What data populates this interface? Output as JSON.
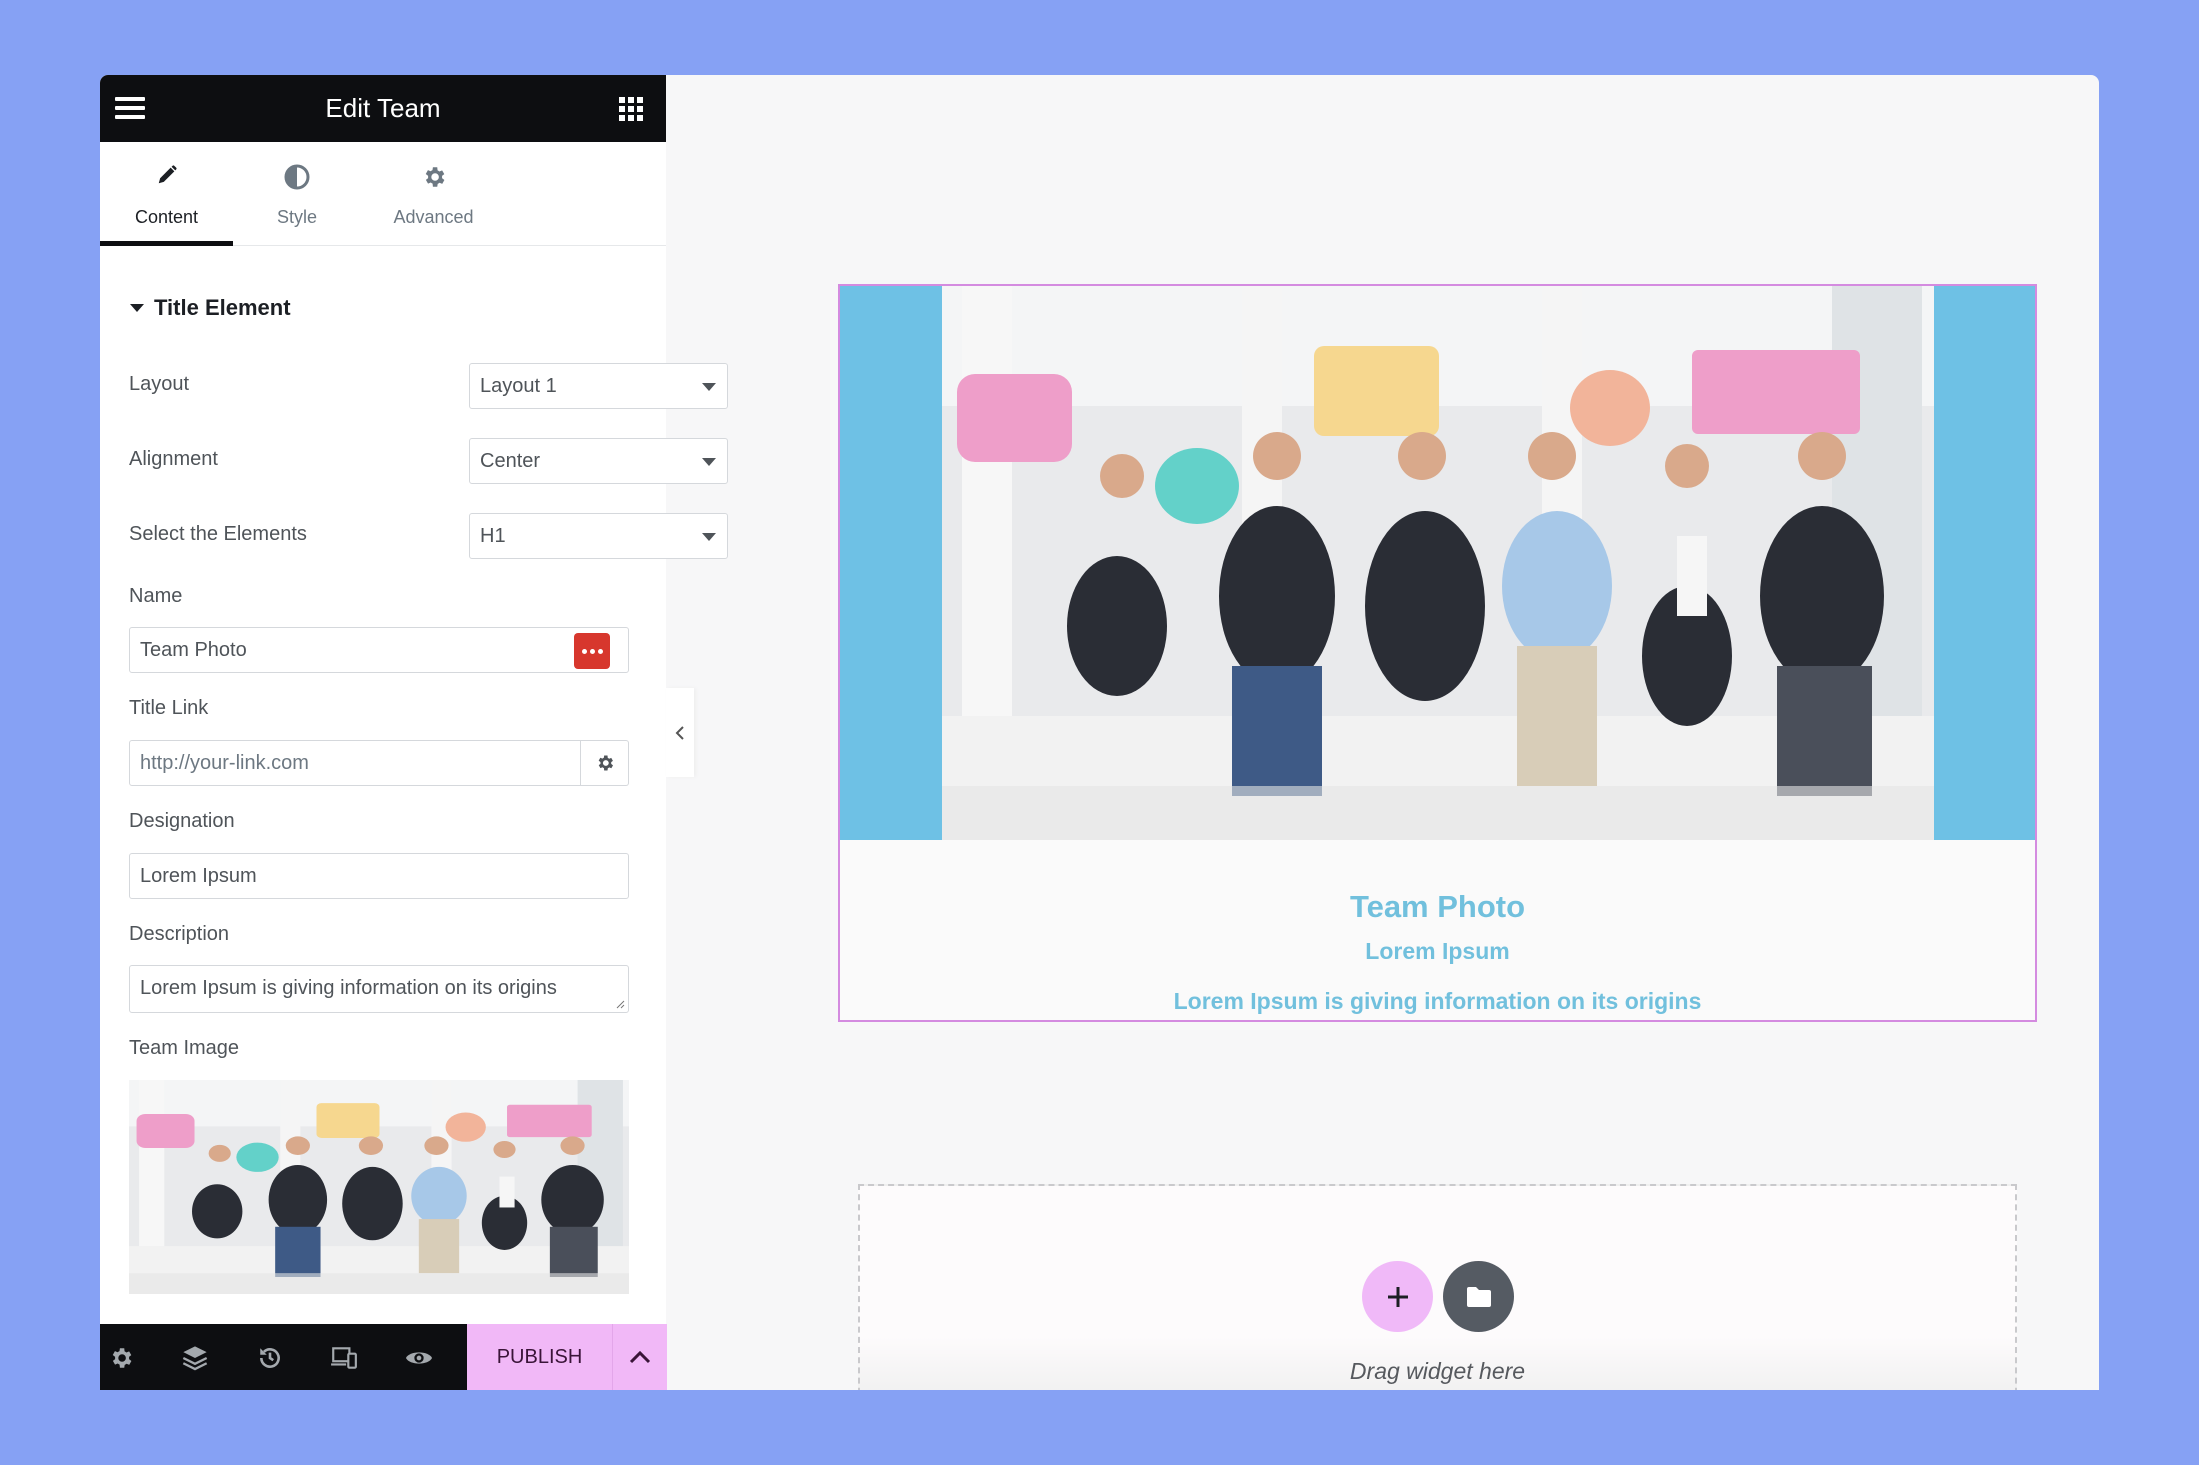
{
  "panel": {
    "title": "Edit Team",
    "tabs": [
      {
        "label": "Content",
        "icon": "pencil-icon",
        "active": true
      },
      {
        "label": "Style",
        "icon": "half-circle-icon",
        "active": false
      },
      {
        "label": "Advanced",
        "icon": "gear-icon",
        "active": false
      }
    ],
    "section_title": "Title Element",
    "fields": {
      "layout": {
        "label": "Layout",
        "value": "Layout 1"
      },
      "alignment": {
        "label": "Alignment",
        "value": "Center"
      },
      "elements": {
        "label": "Select the Elements",
        "value": "H1"
      },
      "name": {
        "label": "Name",
        "value": "Team Photo"
      },
      "title_link": {
        "label": "Title Link",
        "placeholder": "http://your-link.com"
      },
      "designation": {
        "label": "Designation",
        "value": "Lorem Ipsum"
      },
      "description": {
        "label": "Description",
        "value": "Lorem Ipsum is giving information on its origins"
      },
      "team_image": {
        "label": "Team Image"
      }
    },
    "bottom_bar": {
      "icons": [
        "gear-icon",
        "layers-icon",
        "history-icon",
        "responsive-icon",
        "eye-icon"
      ],
      "publish_label": "PUBLISH"
    }
  },
  "canvas": {
    "card": {
      "title": "Team Photo",
      "designation": "Lorem Ipsum",
      "description": "Lorem Ipsum is giving information on its origins"
    },
    "dropzone": {
      "text": "Drag widget here"
    }
  },
  "colors": {
    "background": "#86a1f4",
    "accent_pink": "#f1b8f7",
    "card_text": "#71c0dd",
    "image_bg": "#6ec1e5",
    "card_border": "#d48be0",
    "dynamic_tag": "#d7372d"
  }
}
